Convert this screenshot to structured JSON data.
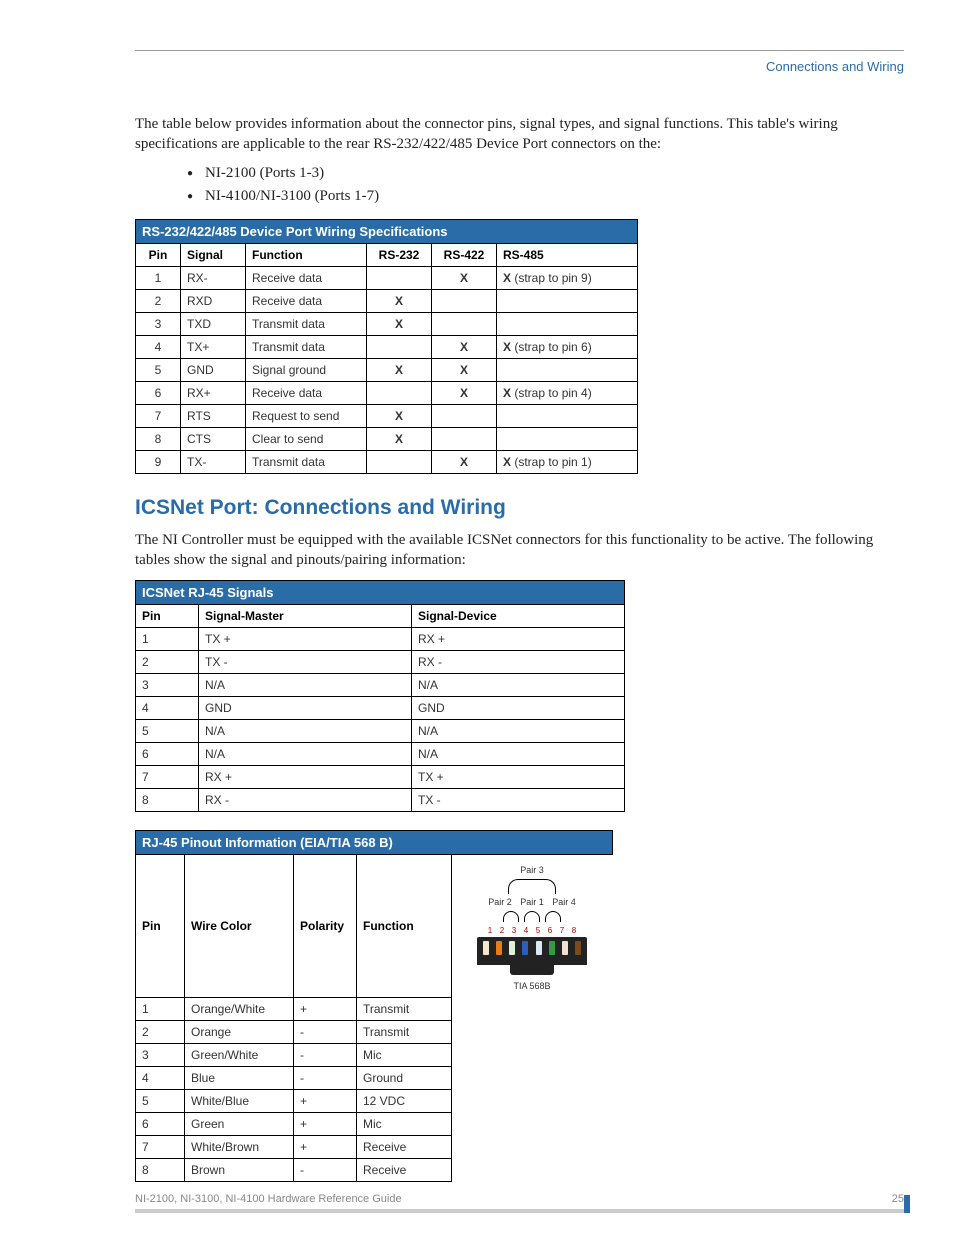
{
  "header": {
    "title": "Connections and Wiring"
  },
  "intro": {
    "para1": "The table below provides information about the connector pins, signal types, and signal functions. This table's wiring specifications are applicable to the rear RS-232/422/485 Device Port connectors on the:",
    "bullets": [
      "NI-2100 (Ports 1-3)",
      "NI-4100/NI-3100 (Ports 1-7)"
    ]
  },
  "table1": {
    "title": "RS-232/422/485 Device Port Wiring Specifications",
    "headers": [
      "Pin",
      "Signal",
      "Function",
      "RS-232",
      "RS-422",
      "RS-485"
    ],
    "rows": [
      {
        "pin": "1",
        "signal": "RX-",
        "function": "Receive data",
        "rs232": "",
        "rs422": "X",
        "rs485": "X (strap to pin 9)"
      },
      {
        "pin": "2",
        "signal": "RXD",
        "function": "Receive data",
        "rs232": "X",
        "rs422": "",
        "rs485": ""
      },
      {
        "pin": "3",
        "signal": "TXD",
        "function": "Transmit data",
        "rs232": "X",
        "rs422": "",
        "rs485": ""
      },
      {
        "pin": "4",
        "signal": "TX+",
        "function": "Transmit data",
        "rs232": "",
        "rs422": "X",
        "rs485": "X (strap to pin 6)"
      },
      {
        "pin": "5",
        "signal": "GND",
        "function": "Signal ground",
        "rs232": "X",
        "rs422": "X",
        "rs485": ""
      },
      {
        "pin": "6",
        "signal": "RX+",
        "function": "Receive data",
        "rs232": "",
        "rs422": "X",
        "rs485": "X (strap to pin 4)"
      },
      {
        "pin": "7",
        "signal": "RTS",
        "function": "Request to send",
        "rs232": "X",
        "rs422": "",
        "rs485": ""
      },
      {
        "pin": "8",
        "signal": "CTS",
        "function": "Clear to send",
        "rs232": "X",
        "rs422": "",
        "rs485": ""
      },
      {
        "pin": "9",
        "signal": "TX-",
        "function": "Transmit data",
        "rs232": "",
        "rs422": "X",
        "rs485": "X (strap to pin 1)"
      }
    ]
  },
  "section2": {
    "heading": "ICSNet Port: Connections and Wiring",
    "para": "The NI Controller must be equipped with the available ICSNet connectors for this functionality to be active. The following tables show the signal and pinouts/pairing information:"
  },
  "table2": {
    "title": "ICSNet RJ-45 Signals",
    "headers": [
      "Pin",
      "Signal-Master",
      "Signal-Device"
    ],
    "rows": [
      {
        "pin": "1",
        "master": "TX +",
        "device": "RX +"
      },
      {
        "pin": "2",
        "master": "TX -",
        "device": "RX -"
      },
      {
        "pin": "3",
        "master": "N/A",
        "device": "N/A"
      },
      {
        "pin": "4",
        "master": "GND",
        "device": "GND"
      },
      {
        "pin": "5",
        "master": "N/A",
        "device": "N/A"
      },
      {
        "pin": "6",
        "master": "N/A",
        "device": "N/A"
      },
      {
        "pin": "7",
        "master": "RX +",
        "device": "TX +"
      },
      {
        "pin": "8",
        "master": "RX -",
        "device": "TX -"
      }
    ]
  },
  "table3": {
    "title": "RJ-45 Pinout Information (EIA/TIA 568 B)",
    "headers": [
      "Pin",
      "Wire Color",
      "Polarity",
      "Function"
    ],
    "rows": [
      {
        "pin": "1",
        "color": "Orange/White",
        "pol": "+",
        "fun": "Transmit"
      },
      {
        "pin": "2",
        "color": "Orange",
        "pol": "-",
        "fun": "Transmit"
      },
      {
        "pin": "3",
        "color": "Green/White",
        "pol": "-",
        "fun": "Mic"
      },
      {
        "pin": "4",
        "color": "Blue",
        "pol": "-",
        "fun": "Ground"
      },
      {
        "pin": "5",
        "color": "White/Blue",
        "pol": "+",
        "fun": "12 VDC"
      },
      {
        "pin": "6",
        "color": "Green",
        "pol": "+",
        "fun": "Mic"
      },
      {
        "pin": "7",
        "color": "White/Brown",
        "pol": "+",
        "fun": "Receive"
      },
      {
        "pin": "8",
        "color": "Brown",
        "pol": "-",
        "fun": "Receive"
      }
    ],
    "diagram": {
      "pair_top": "Pair 3",
      "pairs": [
        "Pair 2",
        "Pair 1",
        "Pair 4"
      ],
      "pins": [
        "1",
        "2",
        "3",
        "4",
        "5",
        "6",
        "7",
        "8"
      ],
      "caption": "TIA 568B"
    }
  },
  "footer": {
    "left": "NI-2100, NI-3100, NI-4100 Hardware Reference Guide",
    "right": "25"
  }
}
